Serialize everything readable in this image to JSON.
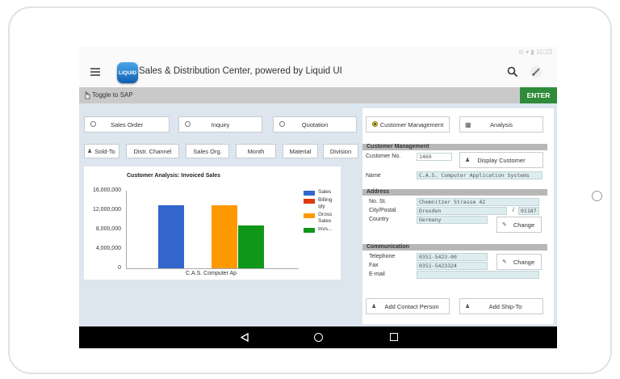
{
  "app": {
    "title": "Sales & Distribution Center, powered by Liquid UI",
    "logo_text": "LIQUID",
    "status_text": "⊝ ▾ ▮ 10:23"
  },
  "toggle": {
    "label": "Toggle to SAP",
    "enter_label": "ENTER"
  },
  "left_tabs": [
    {
      "label": "Sales Order",
      "icon": "radio-icon"
    },
    {
      "label": "Inquiry",
      "icon": "radio-icon"
    },
    {
      "label": "Quotation",
      "icon": "radio-icon"
    }
  ],
  "filters": [
    "Sold-To",
    "Distr. Channel",
    "Sales Org.",
    "Month",
    "Material",
    "Division"
  ],
  "chart_data": {
    "type": "bar",
    "title": "Customer Analysis: Invoiced Sales",
    "categories": [
      "C.A.S. Computer Ap"
    ],
    "yticks": [
      "16,000,000",
      "12,000,000",
      "8,000,000",
      "4,000,000",
      "0"
    ],
    "ylim": [
      0,
      16000000
    ],
    "series": [
      {
        "name": "Sales",
        "values": [
          13000000
        ],
        "color": "#3366cc"
      },
      {
        "name": "Billing qty",
        "values": [
          0
        ],
        "color": "#dc3912"
      },
      {
        "name": "Gross Sales",
        "values": [
          13000000
        ],
        "color": "#ff9900"
      },
      {
        "name": "Invs...",
        "values": [
          8800000
        ],
        "color": "#109618"
      }
    ],
    "legend_position": "right"
  },
  "right_tabs": [
    {
      "label": "Customer Management"
    },
    {
      "label": "Analysis"
    }
  ],
  "customer": {
    "section_title": "Customer Management",
    "customer_no_label": "Customer No.",
    "customer_no_value": "1460",
    "display_button": "Display Customer",
    "name_label": "Name",
    "name_value": "C.A.S. Computer Application Systems"
  },
  "address": {
    "section_title": "Address",
    "street_label": "No. St.",
    "street_value": "Chemnitzer Strasse 42",
    "city_label": "City/Postal",
    "city_value": "Dresden",
    "postal_sep": "/",
    "postal_value": "01187",
    "country_label": "Country",
    "country_value": "Germany",
    "change_button": "Change"
  },
  "communication": {
    "section_title": "Communication",
    "telephone_label": "Telephone",
    "telephone_value": "0351-5423-00",
    "fax_label": "Fax",
    "fax_value": "0351-5423324",
    "email_label": "E-mail",
    "email_value": "",
    "change_button": "Change"
  },
  "actions": {
    "add_contact": "Add Contact Person",
    "add_shipto": "Add Ship-To"
  }
}
